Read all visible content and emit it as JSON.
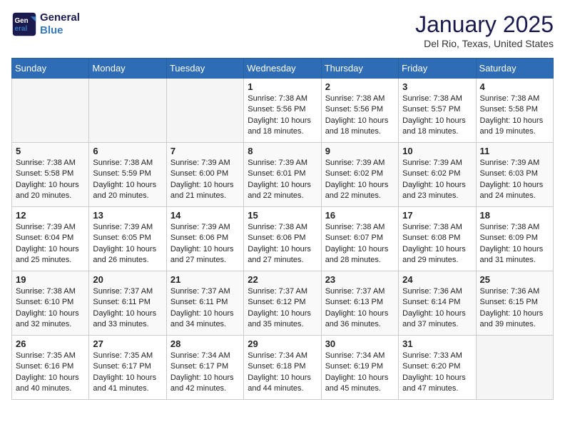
{
  "logo": {
    "line1": "General",
    "line2": "Blue"
  },
  "title": "January 2025",
  "location": "Del Rio, Texas, United States",
  "days_of_week": [
    "Sunday",
    "Monday",
    "Tuesday",
    "Wednesday",
    "Thursday",
    "Friday",
    "Saturday"
  ],
  "weeks": [
    [
      {
        "day": "",
        "info": ""
      },
      {
        "day": "",
        "info": ""
      },
      {
        "day": "",
        "info": ""
      },
      {
        "day": "1",
        "info": "Sunrise: 7:38 AM\nSunset: 5:56 PM\nDaylight: 10 hours and 18 minutes."
      },
      {
        "day": "2",
        "info": "Sunrise: 7:38 AM\nSunset: 5:56 PM\nDaylight: 10 hours and 18 minutes."
      },
      {
        "day": "3",
        "info": "Sunrise: 7:38 AM\nSunset: 5:57 PM\nDaylight: 10 hours and 18 minutes."
      },
      {
        "day": "4",
        "info": "Sunrise: 7:38 AM\nSunset: 5:58 PM\nDaylight: 10 hours and 19 minutes."
      }
    ],
    [
      {
        "day": "5",
        "info": "Sunrise: 7:38 AM\nSunset: 5:58 PM\nDaylight: 10 hours and 20 minutes."
      },
      {
        "day": "6",
        "info": "Sunrise: 7:38 AM\nSunset: 5:59 PM\nDaylight: 10 hours and 20 minutes."
      },
      {
        "day": "7",
        "info": "Sunrise: 7:39 AM\nSunset: 6:00 PM\nDaylight: 10 hours and 21 minutes."
      },
      {
        "day": "8",
        "info": "Sunrise: 7:39 AM\nSunset: 6:01 PM\nDaylight: 10 hours and 22 minutes."
      },
      {
        "day": "9",
        "info": "Sunrise: 7:39 AM\nSunset: 6:02 PM\nDaylight: 10 hours and 22 minutes."
      },
      {
        "day": "10",
        "info": "Sunrise: 7:39 AM\nSunset: 6:02 PM\nDaylight: 10 hours and 23 minutes."
      },
      {
        "day": "11",
        "info": "Sunrise: 7:39 AM\nSunset: 6:03 PM\nDaylight: 10 hours and 24 minutes."
      }
    ],
    [
      {
        "day": "12",
        "info": "Sunrise: 7:39 AM\nSunset: 6:04 PM\nDaylight: 10 hours and 25 minutes."
      },
      {
        "day": "13",
        "info": "Sunrise: 7:39 AM\nSunset: 6:05 PM\nDaylight: 10 hours and 26 minutes."
      },
      {
        "day": "14",
        "info": "Sunrise: 7:39 AM\nSunset: 6:06 PM\nDaylight: 10 hours and 27 minutes."
      },
      {
        "day": "15",
        "info": "Sunrise: 7:38 AM\nSunset: 6:06 PM\nDaylight: 10 hours and 27 minutes."
      },
      {
        "day": "16",
        "info": "Sunrise: 7:38 AM\nSunset: 6:07 PM\nDaylight: 10 hours and 28 minutes."
      },
      {
        "day": "17",
        "info": "Sunrise: 7:38 AM\nSunset: 6:08 PM\nDaylight: 10 hours and 29 minutes."
      },
      {
        "day": "18",
        "info": "Sunrise: 7:38 AM\nSunset: 6:09 PM\nDaylight: 10 hours and 31 minutes."
      }
    ],
    [
      {
        "day": "19",
        "info": "Sunrise: 7:38 AM\nSunset: 6:10 PM\nDaylight: 10 hours and 32 minutes."
      },
      {
        "day": "20",
        "info": "Sunrise: 7:37 AM\nSunset: 6:11 PM\nDaylight: 10 hours and 33 minutes."
      },
      {
        "day": "21",
        "info": "Sunrise: 7:37 AM\nSunset: 6:11 PM\nDaylight: 10 hours and 34 minutes."
      },
      {
        "day": "22",
        "info": "Sunrise: 7:37 AM\nSunset: 6:12 PM\nDaylight: 10 hours and 35 minutes."
      },
      {
        "day": "23",
        "info": "Sunrise: 7:37 AM\nSunset: 6:13 PM\nDaylight: 10 hours and 36 minutes."
      },
      {
        "day": "24",
        "info": "Sunrise: 7:36 AM\nSunset: 6:14 PM\nDaylight: 10 hours and 37 minutes."
      },
      {
        "day": "25",
        "info": "Sunrise: 7:36 AM\nSunset: 6:15 PM\nDaylight: 10 hours and 39 minutes."
      }
    ],
    [
      {
        "day": "26",
        "info": "Sunrise: 7:35 AM\nSunset: 6:16 PM\nDaylight: 10 hours and 40 minutes."
      },
      {
        "day": "27",
        "info": "Sunrise: 7:35 AM\nSunset: 6:17 PM\nDaylight: 10 hours and 41 minutes."
      },
      {
        "day": "28",
        "info": "Sunrise: 7:34 AM\nSunset: 6:17 PM\nDaylight: 10 hours and 42 minutes."
      },
      {
        "day": "29",
        "info": "Sunrise: 7:34 AM\nSunset: 6:18 PM\nDaylight: 10 hours and 44 minutes."
      },
      {
        "day": "30",
        "info": "Sunrise: 7:34 AM\nSunset: 6:19 PM\nDaylight: 10 hours and 45 minutes."
      },
      {
        "day": "31",
        "info": "Sunrise: 7:33 AM\nSunset: 6:20 PM\nDaylight: 10 hours and 47 minutes."
      },
      {
        "day": "",
        "info": ""
      }
    ]
  ]
}
